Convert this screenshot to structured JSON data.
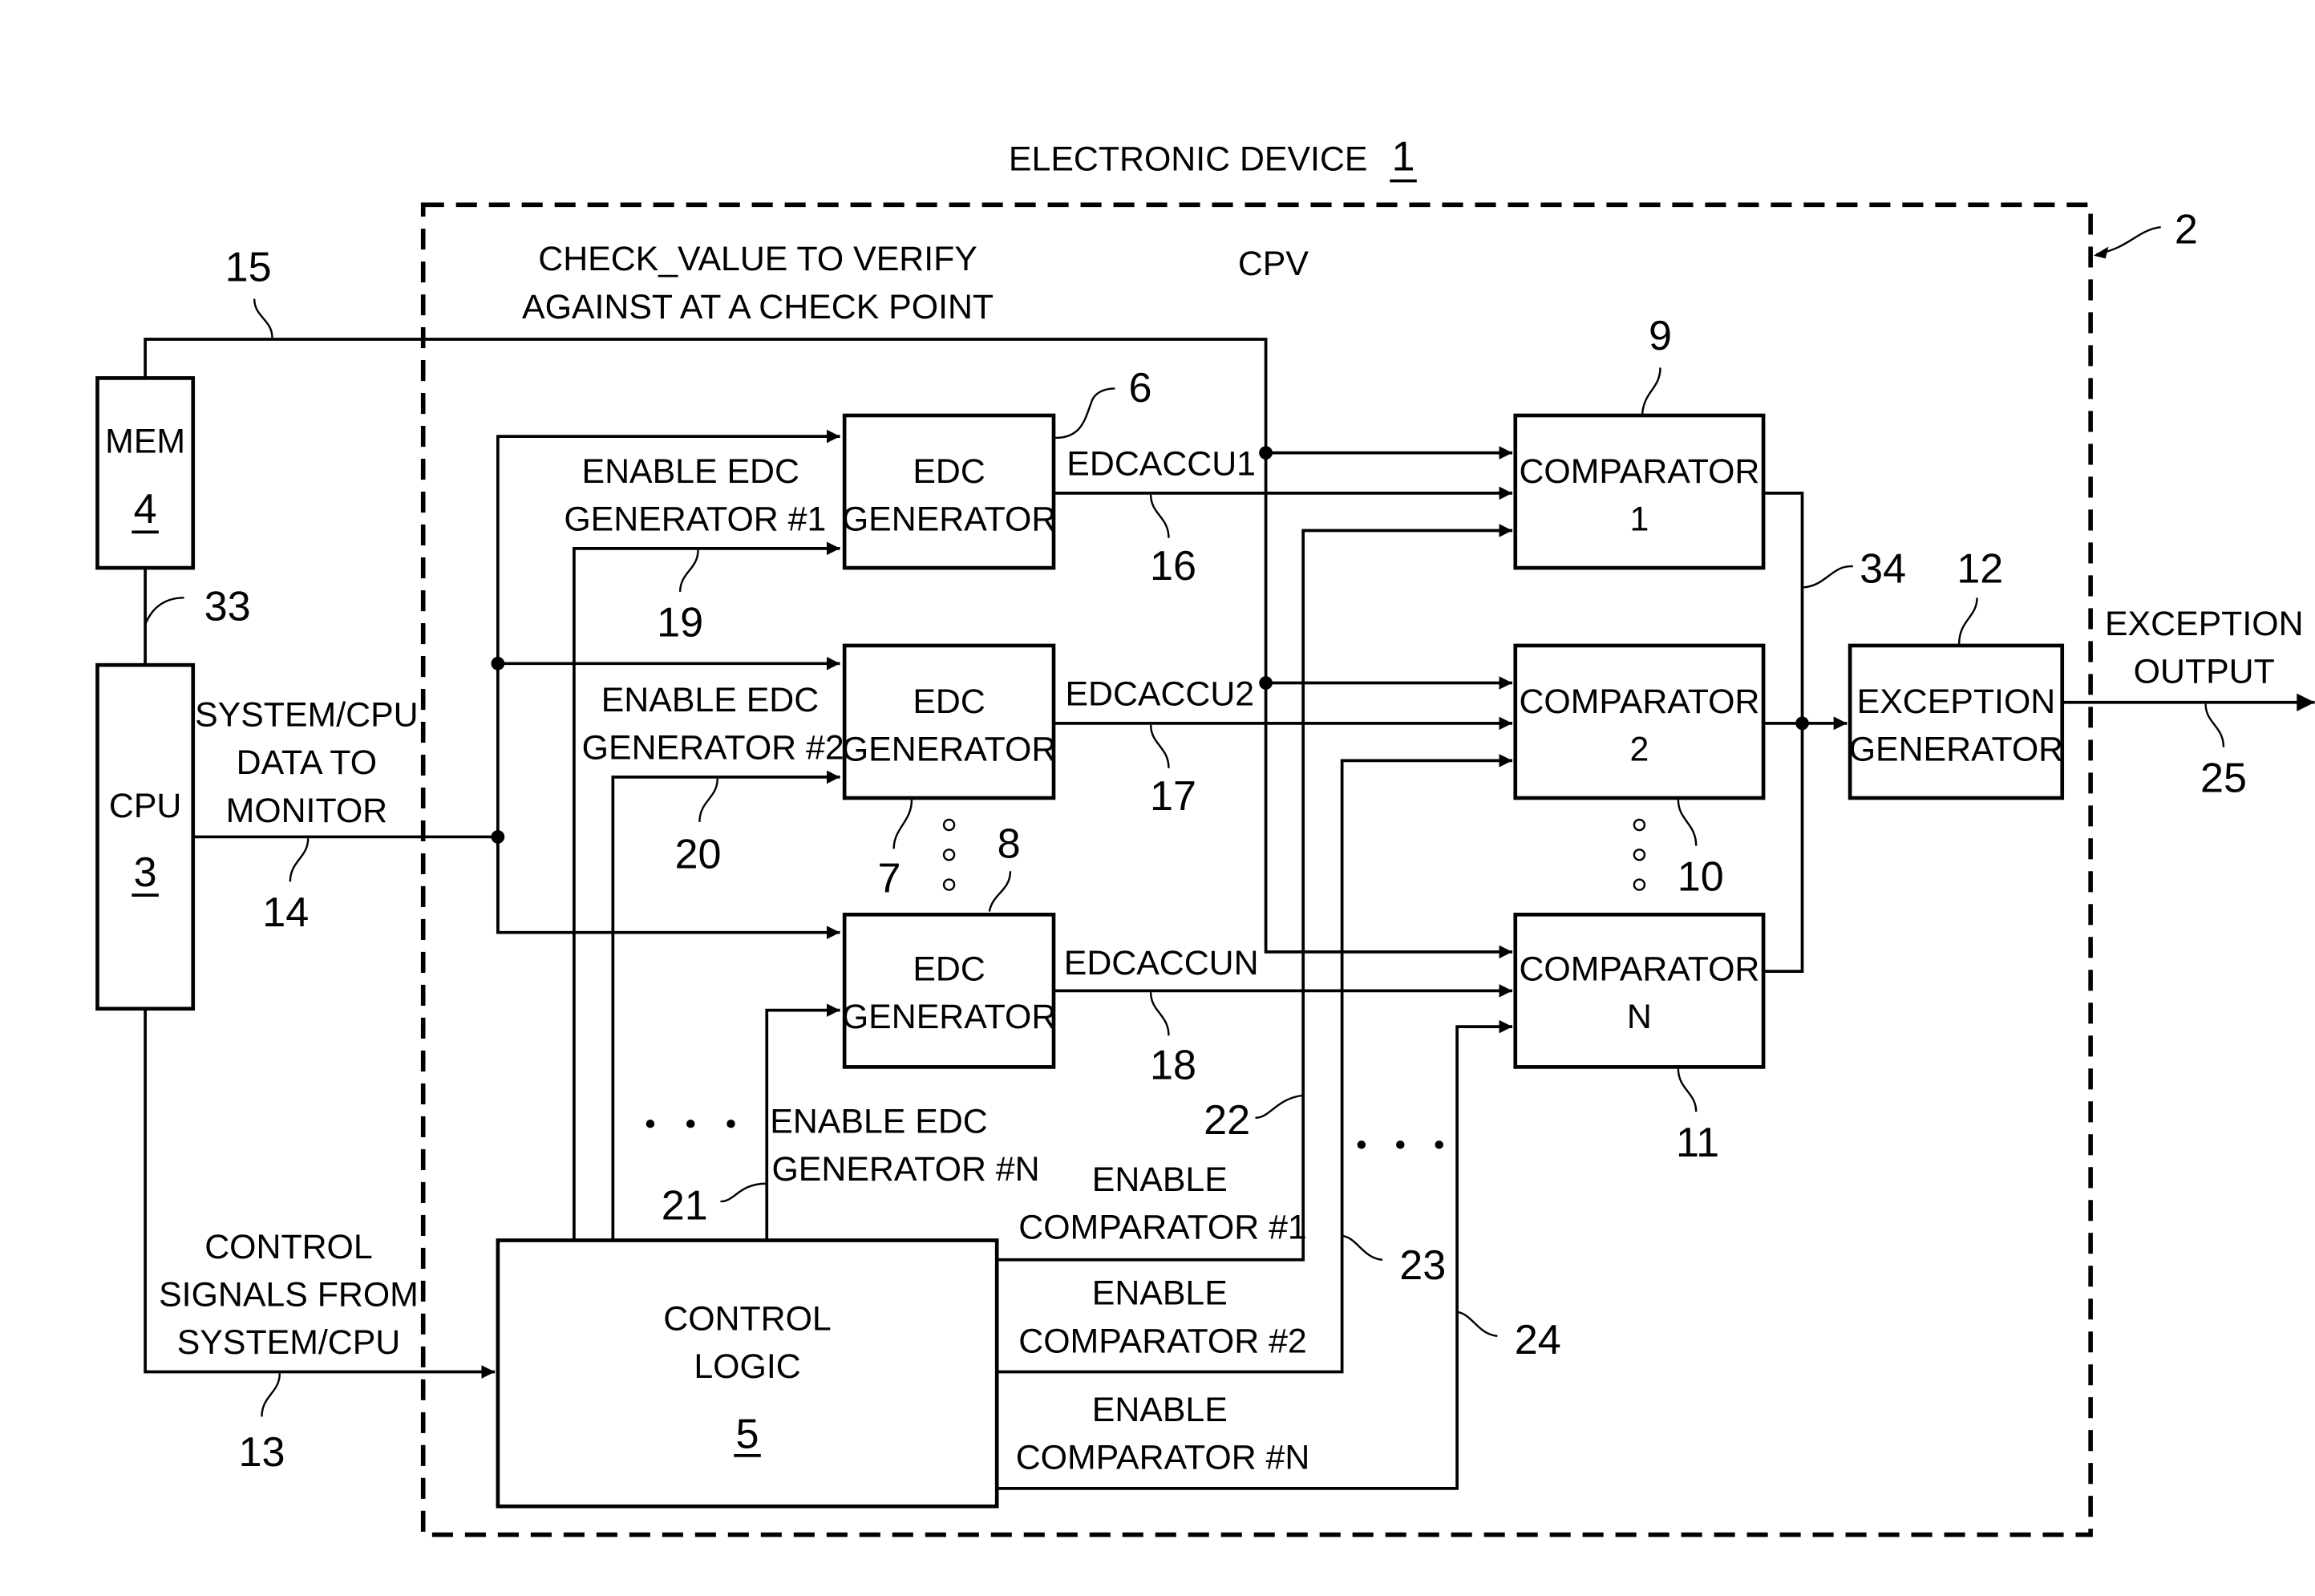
{
  "figure": {
    "title": "ELECTRONIC DEVICE",
    "title_ref": "1",
    "cpv_label": "CPV",
    "cpv_ref": "2"
  },
  "blocks": {
    "mem": {
      "label": "MEM",
      "ref": "4"
    },
    "cpu": {
      "label": "CPU",
      "ref": "3"
    },
    "control_logic": {
      "line1": "CONTROL",
      "line2": "LOGIC",
      "ref": "5"
    },
    "edc_generators": [
      {
        "line1": "EDC",
        "line2": "GENERATOR",
        "ref": "6"
      },
      {
        "line1": "EDC",
        "line2": "GENERATOR",
        "ref": "7"
      },
      {
        "line1": "EDC",
        "line2": "GENERATOR",
        "ref": "8"
      }
    ],
    "comparators": [
      {
        "line1": "COMPARATOR",
        "line2": "1",
        "ref": "9"
      },
      {
        "line1": "COMPARATOR",
        "line2": "2",
        "ref": "10"
      },
      {
        "line1": "COMPARATOR",
        "line2": "N",
        "ref": "11"
      }
    ],
    "exception_generator": {
      "line1": "EXCEPTION",
      "line2": "GENERATOR",
      "ref": "12"
    }
  },
  "signals": {
    "check_value": {
      "line1": "CHECK_VALUE TO VERIFY",
      "line2": "AGAINST AT A CHECK POINT",
      "ref": "15"
    },
    "cpu_data": {
      "line1": "SYSTEM/CPU",
      "line2": "DATA TO",
      "line3": "MONITOR",
      "ref": "14"
    },
    "control_signals": {
      "line1": "CONTROL",
      "line2": "SIGNALS FROM",
      "line3": "SYSTEM/CPU",
      "ref": "13"
    },
    "mem_cpu_bus": {
      "ref": "33"
    },
    "enable_edc": [
      {
        "line1": "ENABLE EDC",
        "line2": "GENERATOR #1",
        "ref": "19"
      },
      {
        "line1": "ENABLE EDC",
        "line2": "GENERATOR #2",
        "ref": "20"
      },
      {
        "line1": "ENABLE EDC",
        "line2": "GENERATOR #N",
        "ref": "21"
      }
    ],
    "edcaccu": [
      {
        "label": "EDCACCU1",
        "ref": "16"
      },
      {
        "label": "EDCACCU2",
        "ref": "17"
      },
      {
        "label": "EDCACCUN",
        "ref": "18"
      }
    ],
    "enable_comparator": [
      {
        "line1": "ENABLE",
        "line2": "COMPARATOR #1",
        "ref": "22"
      },
      {
        "line1": "ENABLE",
        "line2": "COMPARATOR #2",
        "ref": "23"
      },
      {
        "line1": "ENABLE",
        "line2": "COMPARATOR #N",
        "ref": "24"
      }
    ],
    "comparator_bus": {
      "ref": "34"
    },
    "exception_output": {
      "line1": "EXCEPTION",
      "line2": "OUTPUT",
      "ref": "25"
    }
  }
}
